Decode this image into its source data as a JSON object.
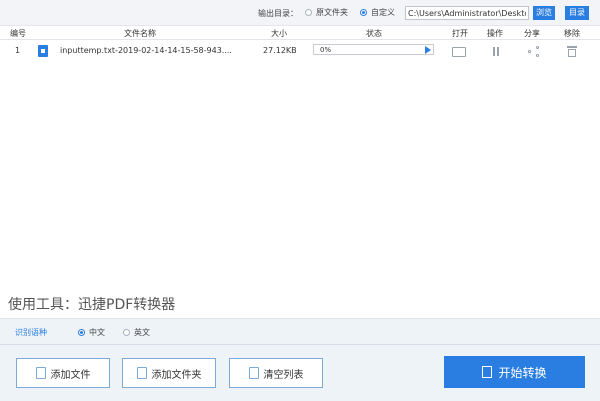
{
  "top_bar": {
    "output_label": "输出目录：",
    "options": [
      {
        "label": "原文件夹",
        "selected": false
      },
      {
        "label": "自定义",
        "selected": true
      }
    ],
    "path_value": "C:\\Users\\Administrator\\Desktop",
    "browse_label": "浏览",
    "dir_label": "目录"
  },
  "table": {
    "headers": {
      "no": "编号",
      "name": "文件名称",
      "size": "大小",
      "status": "状态",
      "open": "打开",
      "operate": "操作",
      "share": "分享",
      "remove": "移除"
    },
    "rows": [
      {
        "no": "1",
        "name": "inputtemp.txt-2019-02-14-14-15-58-943....",
        "size": "27.12KB",
        "progress_text": "0%",
        "progress": 0
      }
    ]
  },
  "tool_text": "使用工具：迅捷PDF转换器",
  "language": {
    "label": "识别语种",
    "options": [
      {
        "label": "中文",
        "selected": true
      },
      {
        "label": "英文",
        "selected": false
      }
    ]
  },
  "buttons": {
    "add_file": "添加文件",
    "add_folder": "添加文件夹",
    "clear_list": "清空列表",
    "start": "开始转换"
  },
  "colors": {
    "accent": "#2a7de1"
  }
}
